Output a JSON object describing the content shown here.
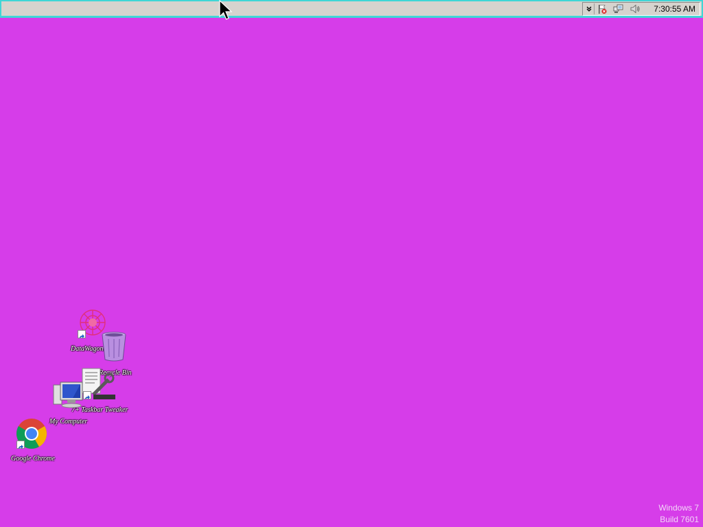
{
  "taskbar": {
    "tray": {
      "expand_icon": "chevron-down-icon",
      "flag_icon": "action-center-flag-icon",
      "network_icon": "network-icon",
      "volume_icon": "volume-icon",
      "clock": "7:30:55 AM"
    },
    "border_color": "#3fd6d6"
  },
  "desktop": {
    "background_color": "#d63de9",
    "icons": [
      {
        "label": "DataWagon.ru",
        "icon": "datawagon-icon",
        "shortcut": true
      },
      {
        "label": "Recycle Bin",
        "icon": "recycle-bin-icon",
        "shortcut": false
      },
      {
        "label": "7+ Taskbar Tweaker",
        "icon": "taskbar-tweaker-icon",
        "shortcut": true
      },
      {
        "label": "My Computer",
        "icon": "computer-icon",
        "shortcut": false
      },
      {
        "label": "Google Chrome",
        "icon": "chrome-icon",
        "shortcut": true
      }
    ]
  },
  "watermark": {
    "line1": "Windows 7",
    "line2": "Build 7601"
  }
}
